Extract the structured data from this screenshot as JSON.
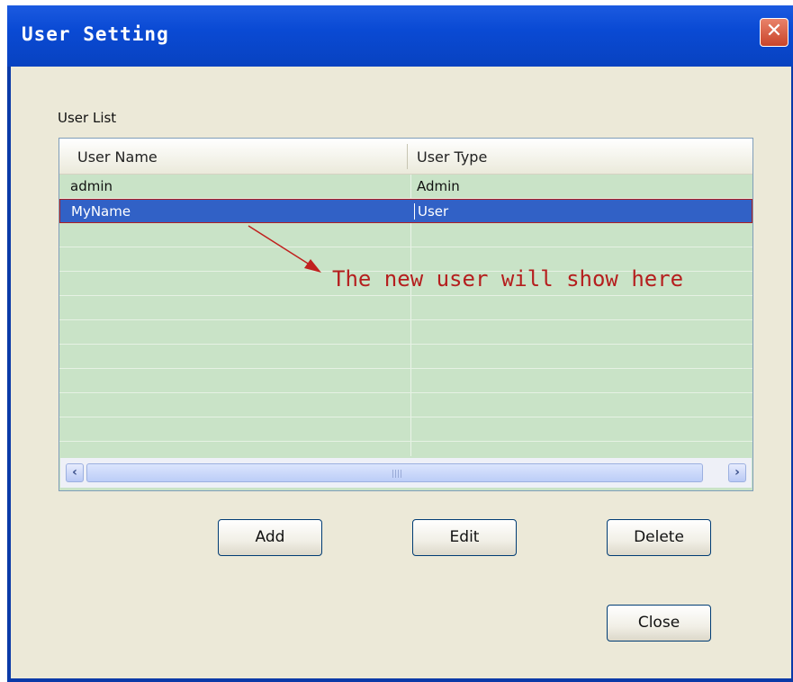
{
  "window": {
    "title": "User Setting",
    "close_glyph": "✕"
  },
  "user_list": {
    "label": "User List",
    "columns": [
      "User Name",
      "User Type"
    ],
    "rows": [
      {
        "name": "admin",
        "type": "Admin"
      },
      {
        "name": "MyName",
        "type": "User"
      }
    ],
    "selected_row": 1,
    "scroll_left_glyph": "‹",
    "scroll_right_glyph": "›",
    "scroll_grip": "||||"
  },
  "buttons": {
    "add": "Add",
    "edit": "Edit",
    "delete": "Delete",
    "close": "Close"
  },
  "annotation": {
    "text": "The new user will show here",
    "color": "#b51e1e"
  },
  "colors": {
    "titlebar": "#0a4ad4",
    "list_background": "#c9e3c7",
    "selection": "#3161c6",
    "dialog_background": "#ece9d8"
  }
}
